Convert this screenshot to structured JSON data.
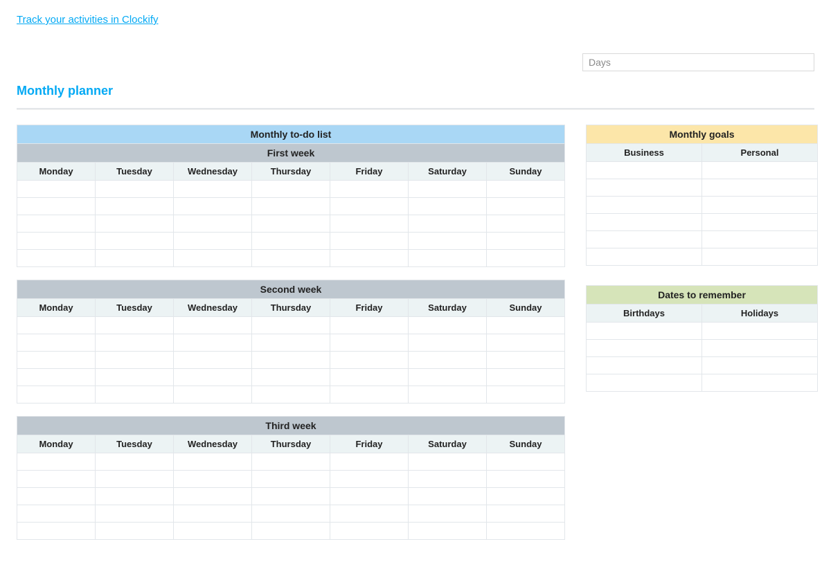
{
  "link_text": "Track your activities in Clockify",
  "days_placeholder": "Days",
  "page_title": "Monthly planner",
  "days": [
    "Monday",
    "Tuesday",
    "Wednesday",
    "Thursday",
    "Friday",
    "Saturday",
    "Sunday"
  ],
  "todo": {
    "title": "Monthly to-do list",
    "weeks": [
      {
        "label": "First week",
        "rows": [
          [
            "",
            "",
            "",
            "",
            "",
            "",
            ""
          ],
          [
            "",
            "",
            "",
            "",
            "",
            "",
            ""
          ],
          [
            "",
            "",
            "",
            "",
            "",
            "",
            ""
          ],
          [
            "",
            "",
            "",
            "",
            "",
            "",
            ""
          ],
          [
            "",
            "",
            "",
            "",
            "",
            "",
            ""
          ]
        ]
      },
      {
        "label": "Second week",
        "rows": [
          [
            "",
            "",
            "",
            "",
            "",
            "",
            ""
          ],
          [
            "",
            "",
            "",
            "",
            "",
            "",
            ""
          ],
          [
            "",
            "",
            "",
            "",
            "",
            "",
            ""
          ],
          [
            "",
            "",
            "",
            "",
            "",
            "",
            ""
          ],
          [
            "",
            "",
            "",
            "",
            "",
            "",
            ""
          ]
        ]
      },
      {
        "label": "Third week",
        "rows": [
          [
            "",
            "",
            "",
            "",
            "",
            "",
            ""
          ],
          [
            "",
            "",
            "",
            "",
            "",
            "",
            ""
          ],
          [
            "",
            "",
            "",
            "",
            "",
            "",
            ""
          ],
          [
            "",
            "",
            "",
            "",
            "",
            "",
            ""
          ],
          [
            "",
            "",
            "",
            "",
            "",
            "",
            ""
          ]
        ]
      }
    ]
  },
  "goals": {
    "title": "Monthly goals",
    "columns": [
      "Business",
      "Personal"
    ],
    "rows": [
      [
        "",
        ""
      ],
      [
        "",
        ""
      ],
      [
        "",
        ""
      ],
      [
        "",
        ""
      ],
      [
        "",
        ""
      ],
      [
        "",
        ""
      ]
    ]
  },
  "dates": {
    "title": "Dates to remember",
    "columns": [
      "Birthdays",
      "Holidays"
    ],
    "rows": [
      [
        "",
        ""
      ],
      [
        "",
        ""
      ],
      [
        "",
        ""
      ],
      [
        "",
        ""
      ]
    ]
  }
}
